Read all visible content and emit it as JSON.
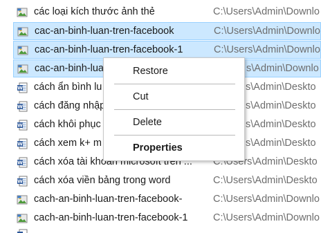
{
  "files": [
    {
      "name": "các loại kích thước ảnh thẻ",
      "path": "C:\\Users\\Admin\\Downlo",
      "type": "image",
      "selected": false
    },
    {
      "name": "cac-an-binh-luan-tren-facebook",
      "path": "C:\\Users\\Admin\\Downlo",
      "type": "image",
      "selected": true
    },
    {
      "name": "cac-an-binh-luan-tren-facebook-1",
      "path": "C:\\Users\\Admin\\Downlo",
      "type": "image",
      "selected": true
    },
    {
      "name": "cac-an-binh-lua",
      "path": "s\\Admin\\Downlo",
      "type": "image",
      "selected": true
    },
    {
      "name": "cách ẩn bình lu",
      "path": "s\\Admin\\Deskto",
      "type": "word",
      "selected": false
    },
    {
      "name": "cách đăng nhập",
      "path": "s\\Admin\\Deskto",
      "type": "word",
      "selected": false
    },
    {
      "name": "cách khôi phục",
      "path": "s\\Admin\\Deskto",
      "type": "word",
      "selected": false
    },
    {
      "name": "cách xem k+ m",
      "path": "s\\Admin\\Deskto",
      "type": "word",
      "selected": false
    },
    {
      "name": "cách xóa tài khoản microsoft trên ...",
      "path": "C:\\Users\\Admin\\Deskto",
      "type": "word",
      "selected": false
    },
    {
      "name": "cách xóa viền bảng trong word",
      "path": "C:\\Users\\Admin\\Deskto",
      "type": "word",
      "selected": false
    },
    {
      "name": "cach-an-binh-luan-tren-facebook-",
      "path": "C:\\Users\\Admin\\Downlo",
      "type": "image",
      "selected": false
    },
    {
      "name": "cach-an-binh-luan-tren-facebook-1",
      "path": "C:\\Users\\Admin\\Downlo",
      "type": "image",
      "selected": false
    }
  ],
  "context_menu": {
    "restore": "Restore",
    "cut": "Cut",
    "delete": "Delete",
    "properties": "Properties"
  },
  "colors": {
    "selection_bg": "#cce8ff",
    "selection_border": "#99d1ff",
    "path_text": "#6d6d6d",
    "word_icon": "#2b579a"
  }
}
